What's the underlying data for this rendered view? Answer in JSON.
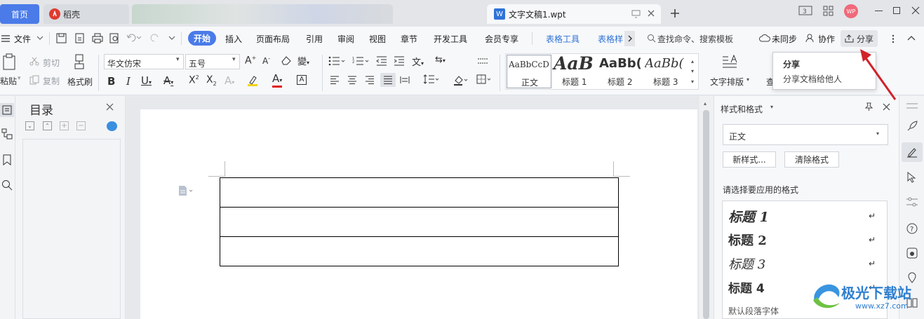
{
  "tabs": {
    "home": "首页",
    "daoke": "稻壳",
    "doc": "文字文稿1.wpt"
  },
  "window": {
    "badge": "WP"
  },
  "menubar": {
    "file": "文件",
    "items": [
      "开始",
      "插入",
      "页面布局",
      "引用",
      "审阅",
      "视图",
      "章节",
      "开发工具",
      "会员专享",
      "表格工具",
      "表格样"
    ],
    "search": "查找命令、搜索模板",
    "sync": "未同步",
    "collab": "协作",
    "share": "分享"
  },
  "ribbon": {
    "paste": "粘贴",
    "cut": "剪切",
    "copy": "复制",
    "format_painter": "格式刷",
    "font": "华文仿宋",
    "size": "五号",
    "styles": [
      {
        "preview": "AaBbCcD",
        "label": "正文"
      },
      {
        "preview": "AaB",
        "label": "标题 1"
      },
      {
        "preview": "AaBb(",
        "label": "标题 2"
      },
      {
        "preview": "AaBb(",
        "label": "标题 3"
      }
    ],
    "text_layout": "文字排版",
    "more": "查"
  },
  "tooltip": {
    "title": "分享",
    "desc": "分享文档给他人"
  },
  "toc": {
    "title": "目录"
  },
  "styles_panel": {
    "title": "样式和格式",
    "current": "正文",
    "new_style": "新样式...",
    "clear_format": "清除格式",
    "apply_label": "请选择要应用的格式",
    "items": [
      "标题 1",
      "标题 2",
      "标题 3",
      "标题 4",
      "默认段落字体"
    ]
  },
  "table": {
    "rows": 3
  },
  "watermark": {
    "name": "极光下载站",
    "url": "www.xz7.com"
  },
  "colors": {
    "accent": "#4a7be8",
    "arrow": "#d0222a",
    "blue_text": "#2f73d8"
  }
}
